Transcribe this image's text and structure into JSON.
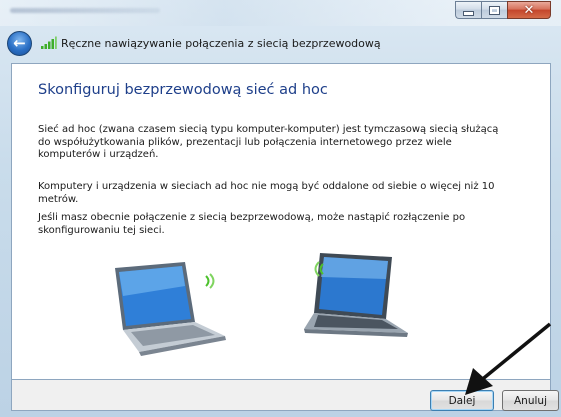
{
  "window": {
    "caption_close_glyph": "✕"
  },
  "nav": {
    "back_glyph": "←",
    "title": "Ręczne nawiązywanie połączenia z siecią bezprzewodową"
  },
  "content": {
    "heading": "Skonfiguruj bezprzewodową sieć ad hoc",
    "paragraph1": "Sieć ad hoc (zwana czasem siecią typu komputer-komputer) jest tymczasową siecią służącą do współużytkowania plików, prezentacji lub połączenia internetowego przez wiele komputerów i urządzeń.",
    "paragraph2": "Komputery i urządzenia w sieciach ad hoc nie mogą być oddalone od siebie o więcej niż 10 metrów.",
    "paragraph3": "Jeśli masz obecnie połączenie z siecią bezprzewodową, może nastąpić rozłączenie po skonfigurowaniu tej sieci."
  },
  "buttons": {
    "next_label": "Dalej",
    "cancel_label": "Anuluj"
  },
  "colors": {
    "heading": "#1e3f8a",
    "signal": "#4cc12c"
  }
}
